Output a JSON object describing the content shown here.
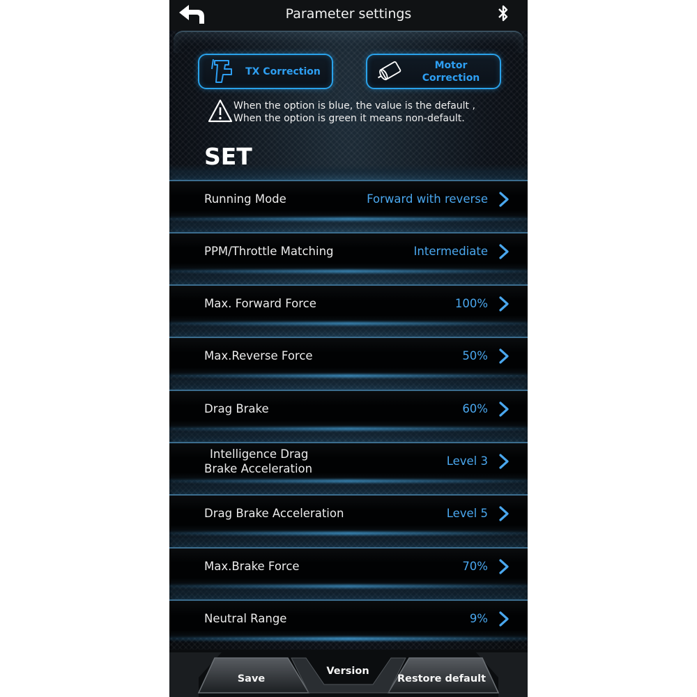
{
  "header": {
    "title": "Parameter settings",
    "back_icon": "back-arrow-icon",
    "bluetooth_icon": "bluetooth-icon"
  },
  "corrections": {
    "tx_label": "TX Correction",
    "motor_label": "Motor Correction"
  },
  "notice": {
    "line1": "When the option is blue, the value is the default ,",
    "line2": "When the option is green it means non-default."
  },
  "section_title": "SET",
  "settings": [
    {
      "label": "Running Mode",
      "value": "Forward with reverse"
    },
    {
      "label": "PPM/Throttle Matching",
      "value": "Intermediate"
    },
    {
      "label": "Max. Forward Force",
      "value": "100%"
    },
    {
      "label": "Max.Reverse Force",
      "value": "50%"
    },
    {
      "label": "Drag Brake",
      "value": "60%"
    },
    {
      "label": "Intelligence Drag\nBrake Acceleration",
      "value": "Level 3"
    },
    {
      "label": "Drag Brake Acceleration",
      "value": "Level 5"
    },
    {
      "label": "Max.Brake Force",
      "value": "70%"
    },
    {
      "label": "Neutral Range",
      "value": "9%"
    }
  ],
  "footer": {
    "save": "Save",
    "version": "Version",
    "restore": "Restore default"
  },
  "colors": {
    "accent": "#2e9ff2",
    "value_default": "#4aa7ee",
    "background": "#0c1118"
  }
}
